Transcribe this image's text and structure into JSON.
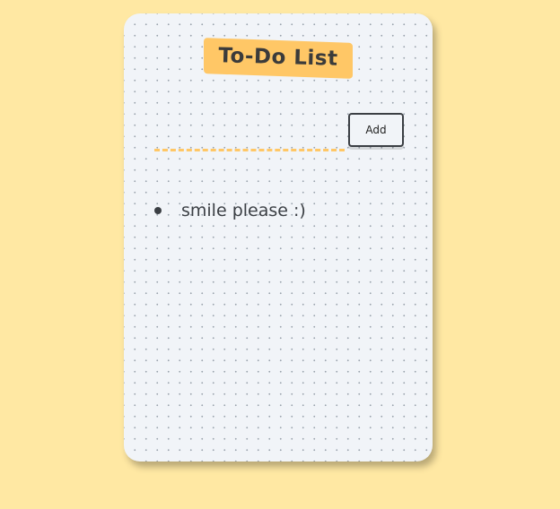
{
  "app": {
    "title": "To-Do List"
  },
  "form": {
    "input_value": "",
    "input_placeholder": "",
    "add_label": "Add"
  },
  "tasks": [
    {
      "text": "smile please :)"
    }
  ],
  "colors": {
    "page_background": "#FFE8A3",
    "card_background": "#F1F4F8",
    "accent": "#FFC766",
    "text": "#3B3F44"
  }
}
